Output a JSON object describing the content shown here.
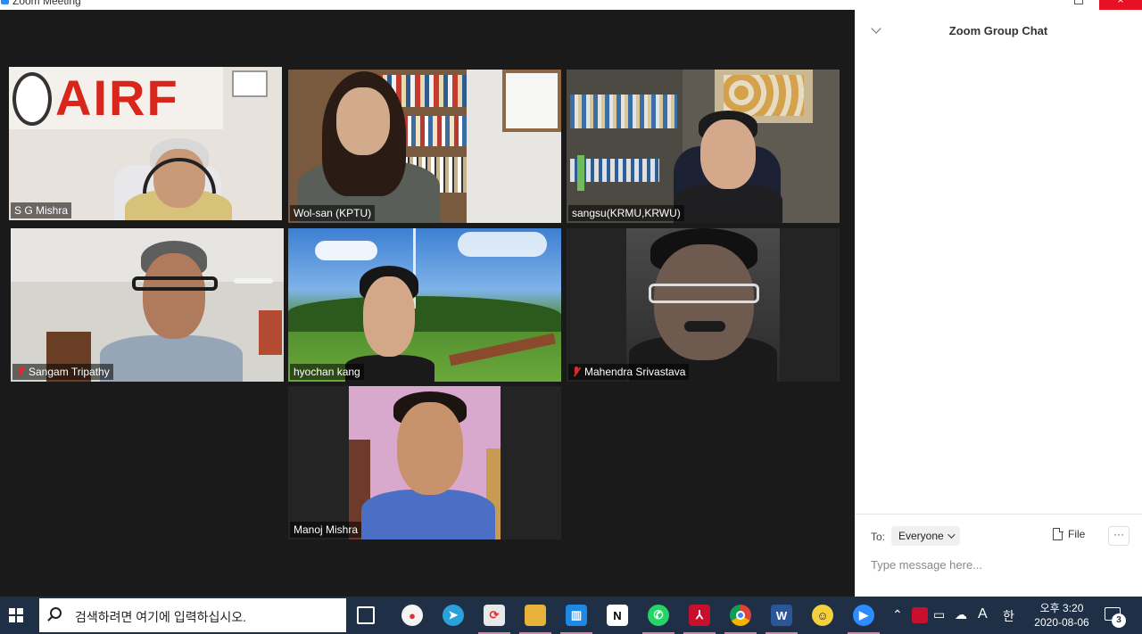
{
  "window": {
    "title": "Zoom Meeting"
  },
  "participants": [
    {
      "name": "S G Mishra",
      "muted": false,
      "active_speaker": true,
      "background_text": "AIRF"
    },
    {
      "name": "Wol-san (KPTU)",
      "muted": false,
      "active_speaker": false
    },
    {
      "name": "sangsu(KRMU,KRWU)",
      "muted": false,
      "active_speaker": false
    },
    {
      "name": "Sangam Tripathy",
      "muted": true,
      "active_speaker": false
    },
    {
      "name": "hyochan kang",
      "muted": false,
      "active_speaker": false
    },
    {
      "name": "Mahendra Srivastava",
      "muted": true,
      "active_speaker": false
    },
    {
      "name": "Manoj Mishra",
      "muted": false,
      "active_speaker": false
    }
  ],
  "chat": {
    "title": "Zoom Group Chat",
    "to_label": "To:",
    "recipient": "Everyone",
    "file_label": "File",
    "more_label": "···",
    "placeholder": "Type message here..."
  },
  "taskbar": {
    "search_placeholder": "검색하려면 여기에 입력하십시오.",
    "clock_time": "오후 3:20",
    "clock_date": "2020-08-06",
    "notification_count": "3",
    "tray_input_lang": "A",
    "tray_ime": "한"
  },
  "colors": {
    "active_speaker_border": "#e7f44f",
    "muted_icon": "#e02828",
    "taskbar": "#1f2f46",
    "close_button": "#e81123"
  }
}
